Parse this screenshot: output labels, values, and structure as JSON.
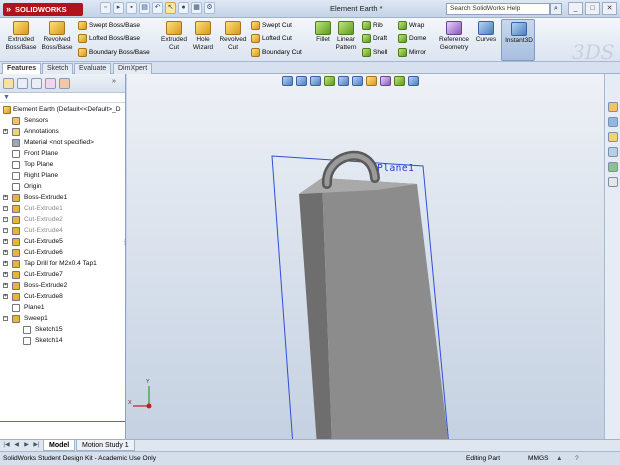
{
  "app": {
    "logo": "SOLIDWORKS",
    "title": "Element Earth *",
    "search_placeholder": "Search SolidWorks Help",
    "watermark": "3DS"
  },
  "ribbon": {
    "extruded_boss": "Extruded Boss/Base",
    "revolved_boss": "Revolved Boss/Base",
    "swept_boss": "Swept Boss/Base",
    "lofted_boss": "Lofted Boss/Base",
    "boundary_boss": "Boundary Boss/Base",
    "extruded_cut": "Extruded Cut",
    "hole_wizard": "Hole Wizard",
    "revolved_cut": "Revolved Cut",
    "swept_cut": "Swept Cut",
    "lofted_cut": "Lofted Cut",
    "boundary_cut": "Boundary Cut",
    "fillet": "Fillet",
    "linear_pattern": "Linear Pattern",
    "rib": "Rib",
    "draft": "Draft",
    "shell": "Shell",
    "wrap": "Wrap",
    "dome": "Dome",
    "mirror": "Mirror",
    "reference_geometry": "Reference Geometry",
    "curves": "Curves",
    "instant3d": "Instant3D"
  },
  "tabs": [
    "Features",
    "Sketch",
    "Evaluate",
    "DimXpert"
  ],
  "tree": {
    "root": "Element Earth  (Default<<Default>_D",
    "items": [
      {
        "label": "Sensors",
        "icon": "sensor-icon",
        "exp": false,
        "dim": false
      },
      {
        "label": "Annotations",
        "icon": "annotation-icon",
        "exp": true,
        "dim": false
      },
      {
        "label": "Material <not specified>",
        "icon": "material-icon",
        "exp": false,
        "dim": false
      },
      {
        "label": "Front Plane",
        "icon": "plane-icon",
        "exp": false,
        "dim": false
      },
      {
        "label": "Top Plane",
        "icon": "plane-icon",
        "exp": false,
        "dim": false
      },
      {
        "label": "Right Plane",
        "icon": "plane-icon",
        "exp": false,
        "dim": false
      },
      {
        "label": "Origin",
        "icon": "origin-icon",
        "exp": false,
        "dim": false
      },
      {
        "label": "Boss-Extrude1",
        "icon": "extrude-icon",
        "exp": true,
        "dim": false
      },
      {
        "label": "Cut-Extrude1",
        "icon": "cut-icon",
        "exp": true,
        "dim": true
      },
      {
        "label": "Cut-Extrude2",
        "icon": "cut-icon",
        "exp": true,
        "dim": true
      },
      {
        "label": "Cut-Extrude4",
        "icon": "cut-icon",
        "exp": true,
        "dim": true
      },
      {
        "label": "Cut-Extrude5",
        "icon": "cut-icon",
        "exp": true,
        "dim": false
      },
      {
        "label": "Cut-Extrude6",
        "icon": "cut-icon",
        "exp": true,
        "dim": false
      },
      {
        "label": "Tap Drill for M2x0.4 Tap1",
        "icon": "hole-icon",
        "exp": true,
        "dim": false
      },
      {
        "label": "Cut-Extrude7",
        "icon": "cut-icon",
        "exp": true,
        "dim": false
      },
      {
        "label": "Boss-Extrude2",
        "icon": "extrude-icon",
        "exp": true,
        "dim": false
      },
      {
        "label": "Cut-Extrude8",
        "icon": "cut-icon",
        "exp": true,
        "dim": false
      },
      {
        "label": "Plane1",
        "icon": "plane-icon",
        "exp": false,
        "dim": false
      },
      {
        "label": "Sweep1",
        "icon": "sweep-icon",
        "exp": "open",
        "dim": false
      },
      {
        "label": "Sketch15",
        "icon": "sketch-icon",
        "exp": false,
        "dim": false,
        "indent": true
      },
      {
        "label": "Sketch14",
        "icon": "sketch-icon",
        "exp": false,
        "dim": false,
        "indent": true
      }
    ]
  },
  "viewport": {
    "plane_label": "Plane1",
    "triad": {
      "x": "X",
      "y": "Y"
    }
  },
  "bottom_tabs": [
    "Model",
    "Motion Study 1"
  ],
  "status": {
    "left": "SolidWorks Student Design Kit - Academic Use Only",
    "mode": "Editing Part",
    "units": "MMGS"
  },
  "colors": {
    "accent": "#3f7ac8",
    "plane_outline": "#2f4fd8",
    "part_face": "#8c8c8c"
  }
}
